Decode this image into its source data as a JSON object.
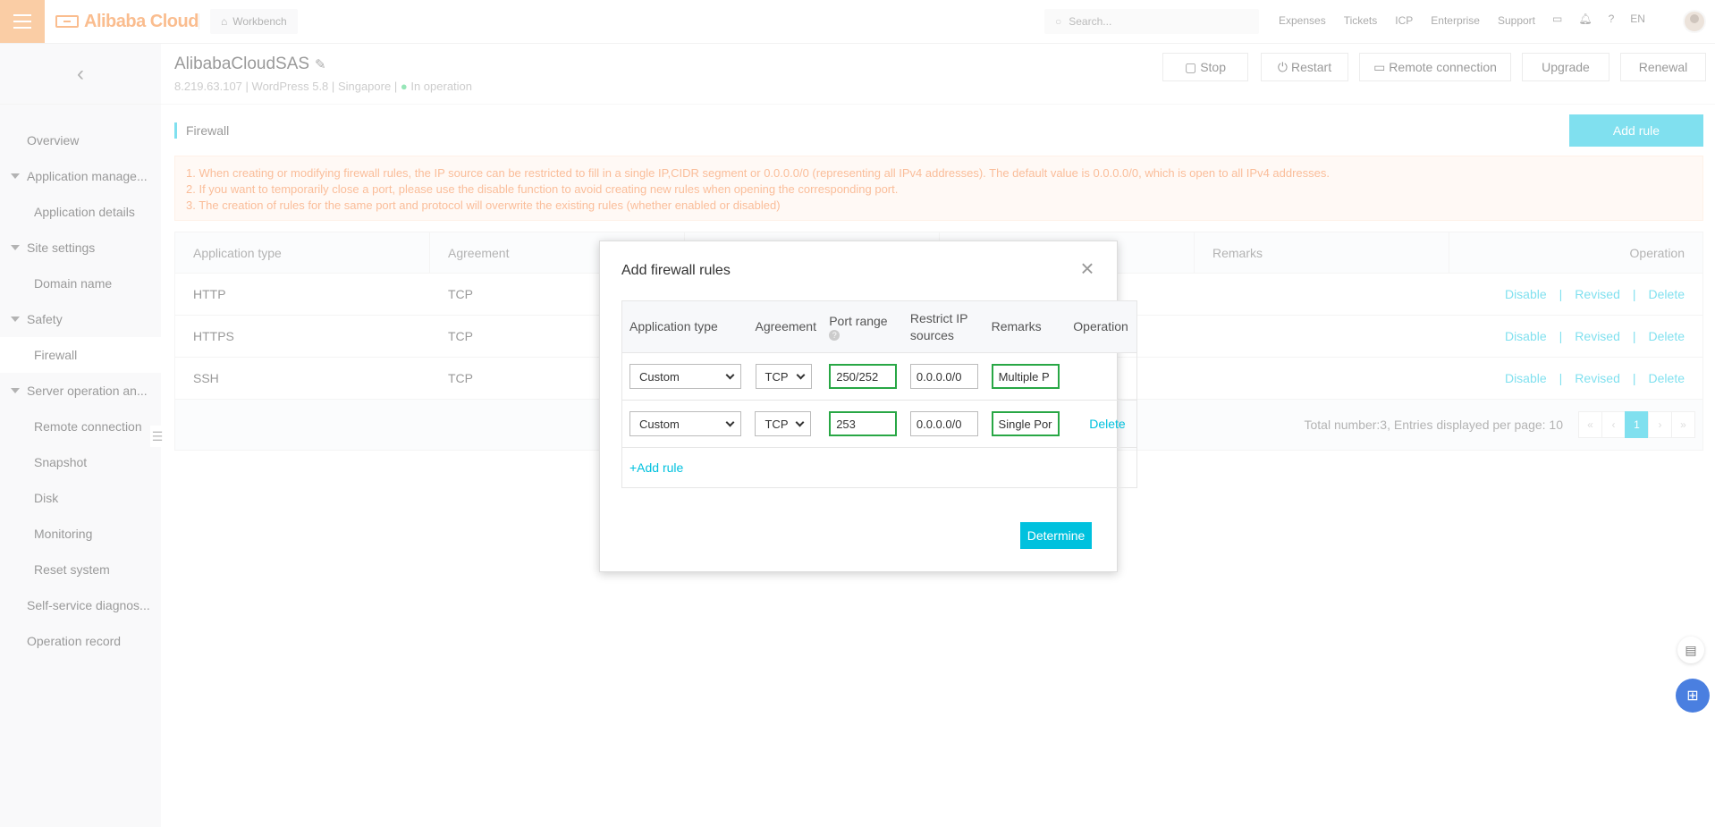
{
  "topbar": {
    "logo_text": "Alibaba Cloud",
    "workbench": "Workbench",
    "search_placeholder": "Search...",
    "nav": [
      "Expenses",
      "Tickets",
      "ICP",
      "Enterprise",
      "Support"
    ],
    "lang": "EN"
  },
  "sidebar": {
    "items": [
      {
        "label": "Overview"
      },
      {
        "label": "Application manage..."
      },
      {
        "label": "Application details"
      },
      {
        "label": "Site settings"
      },
      {
        "label": "Domain name"
      },
      {
        "label": "Safety"
      },
      {
        "label": "Firewall"
      },
      {
        "label": "Server operation an..."
      },
      {
        "label": "Remote connection"
      },
      {
        "label": "Snapshot"
      },
      {
        "label": "Disk"
      },
      {
        "label": "Monitoring"
      },
      {
        "label": "Reset system"
      },
      {
        "label": "Self-service diagnos..."
      },
      {
        "label": "Operation record"
      }
    ]
  },
  "instance": {
    "name": "AlibabaCloudSAS",
    "ip": "8.219.63.107",
    "image": "WordPress 5.8",
    "region": "Singapore",
    "status": "In operation",
    "sep": "|"
  },
  "header_buttons": {
    "stop": "Stop",
    "restart": "Restart",
    "remote": "Remote connection",
    "upgrade": "Upgrade",
    "renewal": "Renewal"
  },
  "firewall": {
    "section_title": "Firewall",
    "add_rule": "Add rule",
    "notice": [
      "1. When creating or modifying firewall rules, the IP source can be restricted to fill in a single IP,CIDR segment or 0.0.0.0/0 (representing all IPv4 addresses). The default value is 0.0.0.0/0, which is open to all IPv4 addresses.",
      "2. If you want to temporarily close a port, please use the disable function to avoid creating new rules when opening the corresponding port.",
      "3. The creation of rules for the same port and protocol will overwrite the existing rules (whether enabled or disabled)"
    ],
    "columns": [
      "Application type",
      "Agreement",
      "Remarks",
      "Operation"
    ],
    "rows": [
      {
        "type": "HTTP",
        "agreement": "TCP"
      },
      {
        "type": "HTTPS",
        "agreement": "TCP"
      },
      {
        "type": "SSH",
        "agreement": "TCP"
      }
    ],
    "row_actions": {
      "disable": "Disable",
      "revised": "Revised",
      "delete": "Delete",
      "sep": "|"
    },
    "footer": "Total number:3, Entries displayed per page: 10",
    "pager": {
      "first": "«",
      "prev": "‹",
      "current": "1",
      "next": "›",
      "last": "»"
    }
  },
  "modal": {
    "title": "Add firewall rules",
    "columns": {
      "type": "Application type",
      "agreement": "Agreement",
      "port": "Port range",
      "restrict_1": "Restrict IP",
      "restrict_2": "sources",
      "remarks": "Remarks",
      "operation": "Operation"
    },
    "rows": [
      {
        "type": "Custom",
        "agreement": "TCP",
        "port": "250/252",
        "ip": "0.0.0.0/0",
        "remarks": "Multiple P",
        "delete": ""
      },
      {
        "type": "Custom",
        "agreement": "TCP",
        "port": "253",
        "ip": "0.0.0.0/0",
        "remarks": "Single Por",
        "delete": "Delete"
      }
    ],
    "add_rule": "+Add rule",
    "determine": "Determine"
  },
  "colors": {
    "accent": "#00c1de",
    "brand": "#f47a1f",
    "notice_text": "#f57a33",
    "valid_border": "#28a745"
  }
}
